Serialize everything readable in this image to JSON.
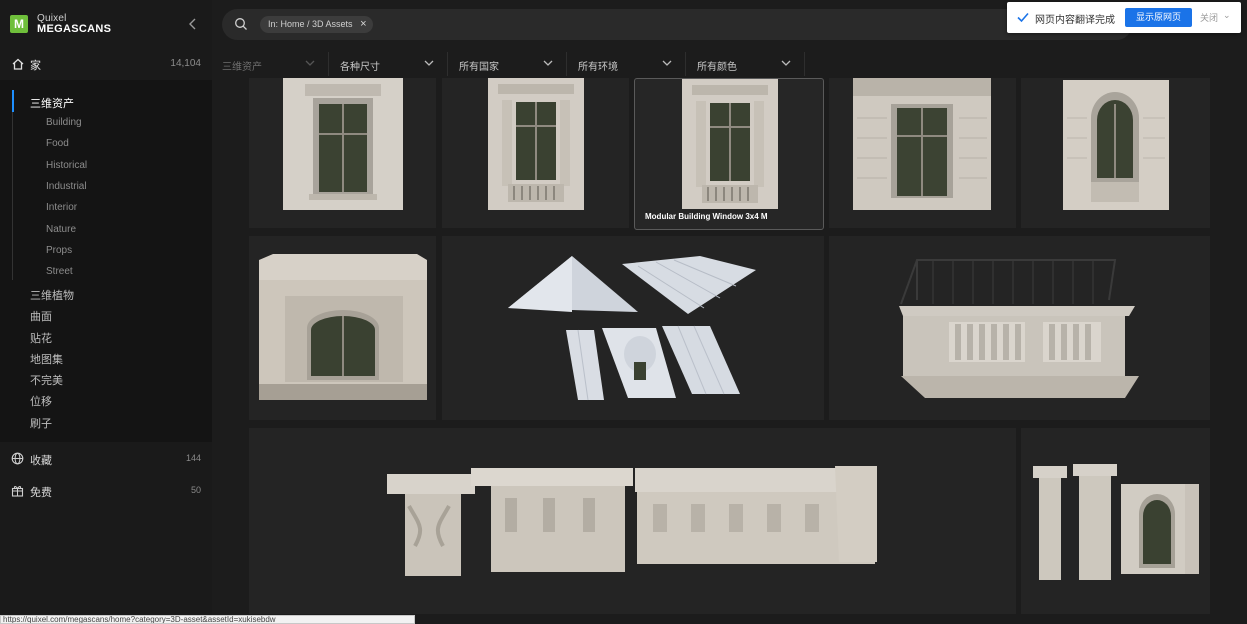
{
  "brand": {
    "line1": "Quixel",
    "line2": "MEGASCANS"
  },
  "sidebar": {
    "home": {
      "label": "家",
      "count": "14,104"
    },
    "categories": [
      {
        "label": "三维资产",
        "active": true
      },
      {
        "label": "三维植物"
      },
      {
        "label": "曲面"
      },
      {
        "label": "贴花"
      },
      {
        "label": "地图集"
      },
      {
        "label": "不完美"
      },
      {
        "label": "位移"
      },
      {
        "label": "刷子"
      }
    ],
    "subcategories": [
      "Building",
      "Food",
      "Historical",
      "Industrial",
      "Interior",
      "Nature",
      "Props",
      "Street"
    ],
    "collections": {
      "label": "收藏",
      "count": "144"
    },
    "free": {
      "label": "免费",
      "count": "50"
    }
  },
  "search": {
    "chip": "In: Home / 3D Assets"
  },
  "translate_popup": {
    "message": "网页内容翻译完成",
    "show_original": "显示原网页",
    "close": "关闭"
  },
  "filters": [
    "三维资产",
    "各种尺寸",
    "所有国家",
    "所有环境",
    "所有颜色"
  ],
  "assets": {
    "hovered_title": "Modular Building Window 3x4 M"
  },
  "status_url": "https://quixel.com/megascans/home?category=3D-asset&assetId=xukisebdw",
  "colors": {
    "accent": "#1e8fff",
    "brand": "#6fbf3b",
    "translate_btn": "#1a73e8"
  }
}
